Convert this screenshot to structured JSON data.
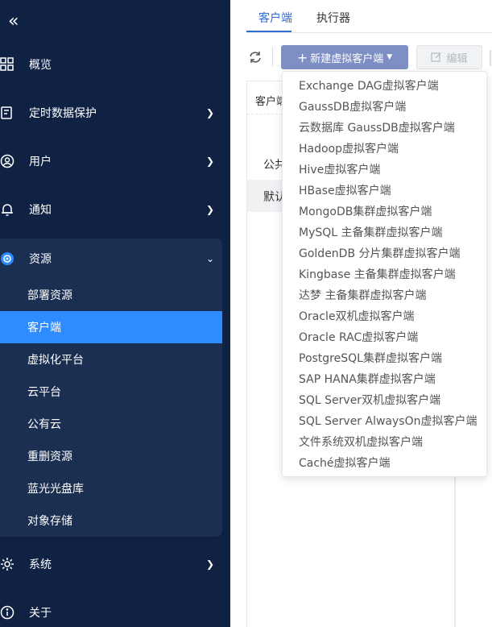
{
  "sidebar": {
    "collapse_icon": "double-chevron-left-icon",
    "items": [
      {
        "label": "概览",
        "icon": "grid-icon"
      },
      {
        "label": "定时数据保护",
        "icon": "calendar-icon"
      },
      {
        "label": "用户",
        "icon": "user-icon"
      },
      {
        "label": "通知",
        "icon": "bell-icon"
      },
      {
        "label": "资源",
        "icon": "resource-icon"
      },
      {
        "label": "系统",
        "icon": "gear-icon"
      },
      {
        "label": "关于",
        "icon": "info-icon"
      }
    ],
    "resource_children": [
      {
        "label": "部署资源"
      },
      {
        "label": "客户端"
      },
      {
        "label": "虚拟化平台"
      },
      {
        "label": "云平台"
      },
      {
        "label": "公有云"
      },
      {
        "label": "重删资源"
      },
      {
        "label": "蓝光光盘库"
      },
      {
        "label": "对象存储"
      }
    ],
    "active_color": "#2f8cff",
    "bg_color": "#0f2244"
  },
  "main": {
    "tabs": [
      {
        "label": "客户端"
      },
      {
        "label": "执行器"
      }
    ],
    "toolbar": {
      "new_label": "新建虚拟客户端",
      "edit_label": "编辑"
    },
    "panel": {
      "header": "客户端",
      "rows": [
        {
          "label": "公共"
        },
        {
          "label": "默认"
        }
      ]
    }
  },
  "dropdown": {
    "options": [
      "Exchange DAG虚拟客户端",
      "GaussDB虚拟客户端",
      "云数据库 GaussDB虚拟客户端",
      "Hadoop虚拟客户端",
      "Hive虚拟客户端",
      "HBase虚拟客户端",
      "MongoDB集群虚拟客户端",
      "MySQL 主备集群虚拟客户端",
      "GoldenDB 分片集群虚拟客户端",
      "Kingbase 主备集群虚拟客户端",
      "达梦 主备集群虚拟客户端",
      "Oracle双机虚拟客户端",
      "Oracle RAC虚拟客户端",
      "PostgreSQL集群虚拟客户端",
      "SAP HANA集群虚拟客户端",
      "SQL Server双机虚拟客户端",
      "SQL Server AlwaysOn虚拟客户端",
      "文件系统双机虚拟客户端",
      "Caché虚拟客户端"
    ]
  }
}
